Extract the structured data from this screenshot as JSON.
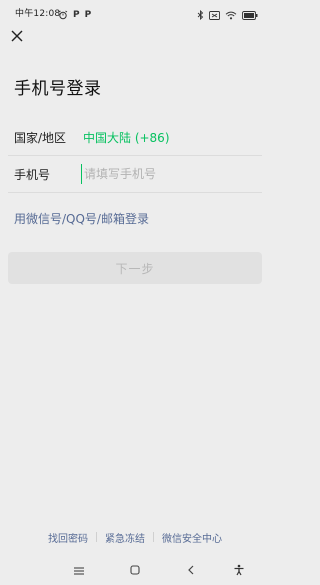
{
  "status_bar": {
    "time": "中午12:08",
    "left_icons": [
      "alarm-icon",
      "p-icon",
      "p-icon"
    ],
    "p_label": "P",
    "right_icons": [
      "bluetooth-icon",
      "battery-saver-icon",
      "wifi-icon",
      "battery-icon"
    ]
  },
  "header": {
    "title": "手机号登录"
  },
  "form": {
    "country_label": "国家/地区",
    "country_value": "中国大陆 (+86)",
    "phone_label": "手机号",
    "phone_placeholder": "请填写手机号",
    "phone_value": ""
  },
  "alt_login_text": "用微信号/QQ号/邮箱登录",
  "next_button_label": "下一步",
  "footer": {
    "links": [
      "找回密码",
      "紧急冻结",
      "微信安全中心"
    ]
  },
  "colors": {
    "accent": "#07c160",
    "link": "#576b95",
    "background": "#ededed"
  }
}
